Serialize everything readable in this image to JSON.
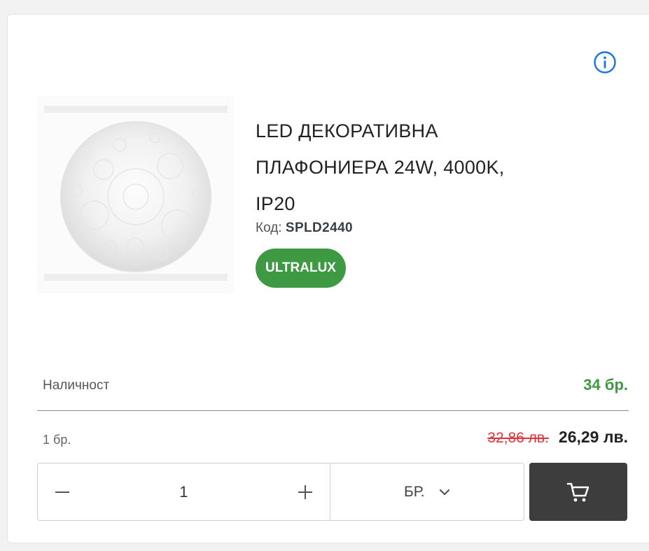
{
  "product": {
    "title_line1": "LED ДЕКОРАТИВНА",
    "title_line2": "ПЛАФОНИЕРА 24W, 4000K,",
    "title_line3": "IP20",
    "code_label": "Код:",
    "code_value": "SPLD2440",
    "brand": "ULTRALUX",
    "image_icon": "round-ceiling-lamp-image"
  },
  "stock": {
    "label": "Наличност",
    "value": "34 бр."
  },
  "pricing": {
    "unit_label": "1 бр.",
    "old_price": "32,86 лв.",
    "new_price": "26,29 лв."
  },
  "quantity": {
    "minus_symbol": "−",
    "value": "1",
    "plus_symbol": "+"
  },
  "unit_select": {
    "selected": "БР."
  },
  "icons": {
    "info": "info-icon",
    "cart": "cart-icon",
    "chevron": "chevron-down-icon"
  },
  "colors": {
    "brand_green": "#3d9a42",
    "old_price_red": "#e0343b",
    "info_blue": "#1a73e8",
    "cart_button_bg": "#3d3d3d"
  }
}
